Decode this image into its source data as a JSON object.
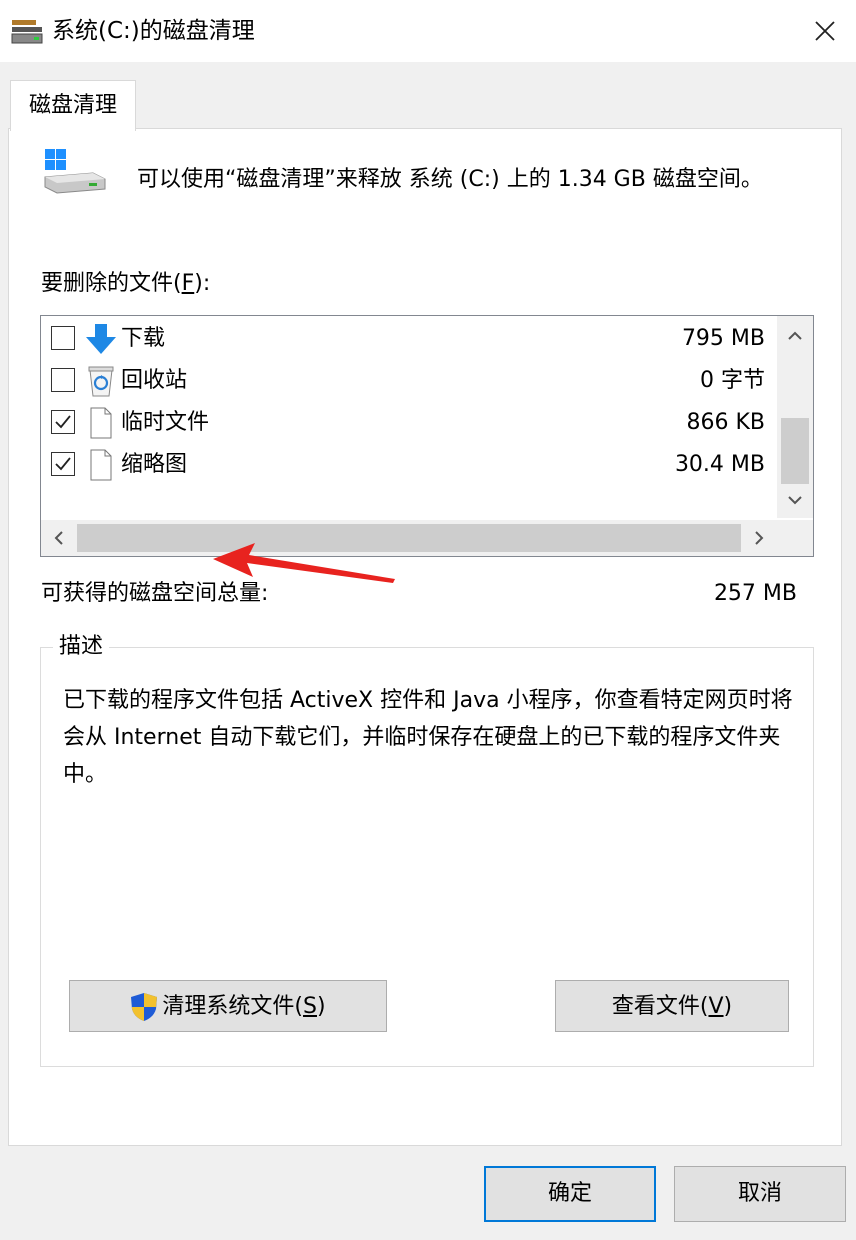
{
  "window": {
    "title": "系统(C:)的磁盘清理",
    "tab_label": "磁盘清理"
  },
  "info": {
    "message": "可以使用“磁盘清理”来释放 系统 (C:) 上的 1.34 GB 磁盘空间。"
  },
  "files_to_delete": {
    "label_prefix": "要删除的文件(",
    "label_key": "F",
    "label_suffix": "):",
    "items": [
      {
        "name": "下载",
        "size": "795 MB",
        "checked": false,
        "icon": "download-arrow-icon"
      },
      {
        "name": "回收站",
        "size": "0 字节",
        "checked": false,
        "icon": "recycle-bin-icon"
      },
      {
        "name": "临时文件",
        "size": "866 KB",
        "checked": true,
        "icon": "file-icon"
      },
      {
        "name": "缩略图",
        "size": "30.4 MB",
        "checked": true,
        "icon": "file-icon"
      }
    ]
  },
  "total": {
    "label": "可获得的磁盘空间总量:",
    "value": "257 MB"
  },
  "description": {
    "legend": "描述",
    "text": "已下载的程序文件包括 ActiveX 控件和 Java 小程序，你查看特定网页时将会从 Internet 自动下载它们，并临时保存在硬盘上的已下载的程序文件夹中。"
  },
  "buttons": {
    "cleanup_prefix": "清理系统文件(",
    "cleanup_key": "S",
    "cleanup_suffix": ")",
    "view_prefix": "查看文件(",
    "view_key": "V",
    "view_suffix": ")",
    "ok": "确定",
    "cancel": "取消"
  },
  "colors": {
    "accent": "#0078d7",
    "annotation_arrow": "#e8231f",
    "download_arrow": "#1e88e5"
  }
}
